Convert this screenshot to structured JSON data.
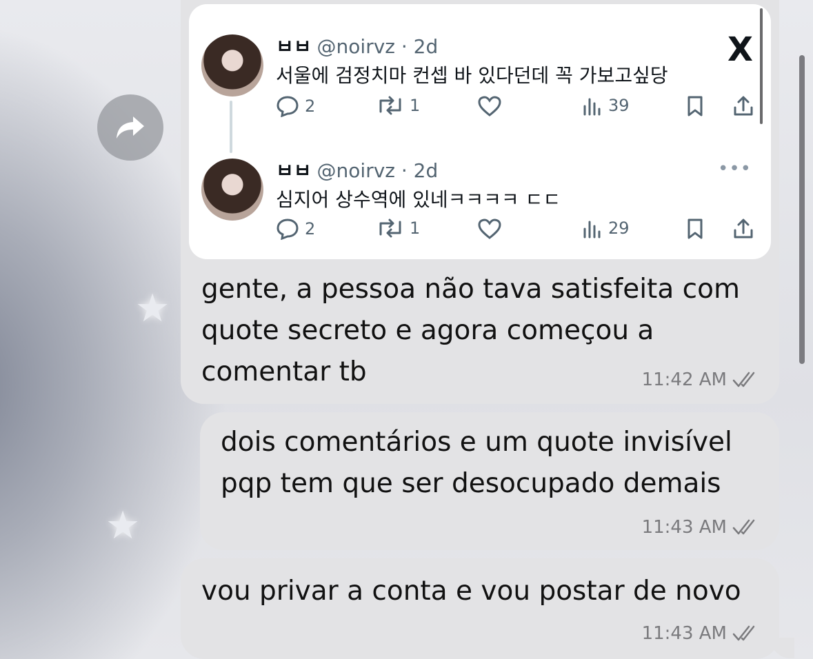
{
  "embedded_post": {
    "posts": [
      {
        "name": "ㅂㅂ",
        "handle": "@noirvz",
        "age": "· 2d",
        "text": "서울에 검정치마 컨셉 바 있다던데 꼭 가보고싶당",
        "replies": "2",
        "reposts": "1",
        "views": "39"
      },
      {
        "name": "ㅂㅂ",
        "handle": "@noirvz",
        "age": "· 2d",
        "text": "심지어 상수역에 있네ㅋㅋㅋㅋ ㄷㄷ",
        "replies": "2",
        "reposts": "1",
        "views": "29"
      }
    ],
    "logo": "X",
    "more_icon": "more-dots-icon"
  },
  "messages": [
    {
      "lines": [
        "gente, a pessoa não tava satisfeita com",
        "quote secreto e agora começou a",
        "comentar tb"
      ],
      "time": "11:42 AM"
    },
    {
      "lines": [
        "dois comentários e um quote invisível",
        "pqp tem que ser desocupado demais"
      ],
      "time": "11:43 AM"
    },
    {
      "lines": [
        "vou privar a conta e vou postar de novo"
      ],
      "time": "11:43 AM"
    }
  ],
  "icons": {
    "forward": "forward-arrow-icon",
    "read_receipt": "double-check-icon",
    "reply": "reply-bubble-icon",
    "repost": "repost-icon",
    "like": "heart-icon",
    "views": "views-bars-icon",
    "bookmark": "bookmark-icon",
    "share": "share-icon",
    "decor": "star-icon"
  },
  "colors": {
    "bubble": "#e3e3e5",
    "card": "#ffffff",
    "muted_text": "#536471",
    "time_text": "#7a7a7d"
  }
}
